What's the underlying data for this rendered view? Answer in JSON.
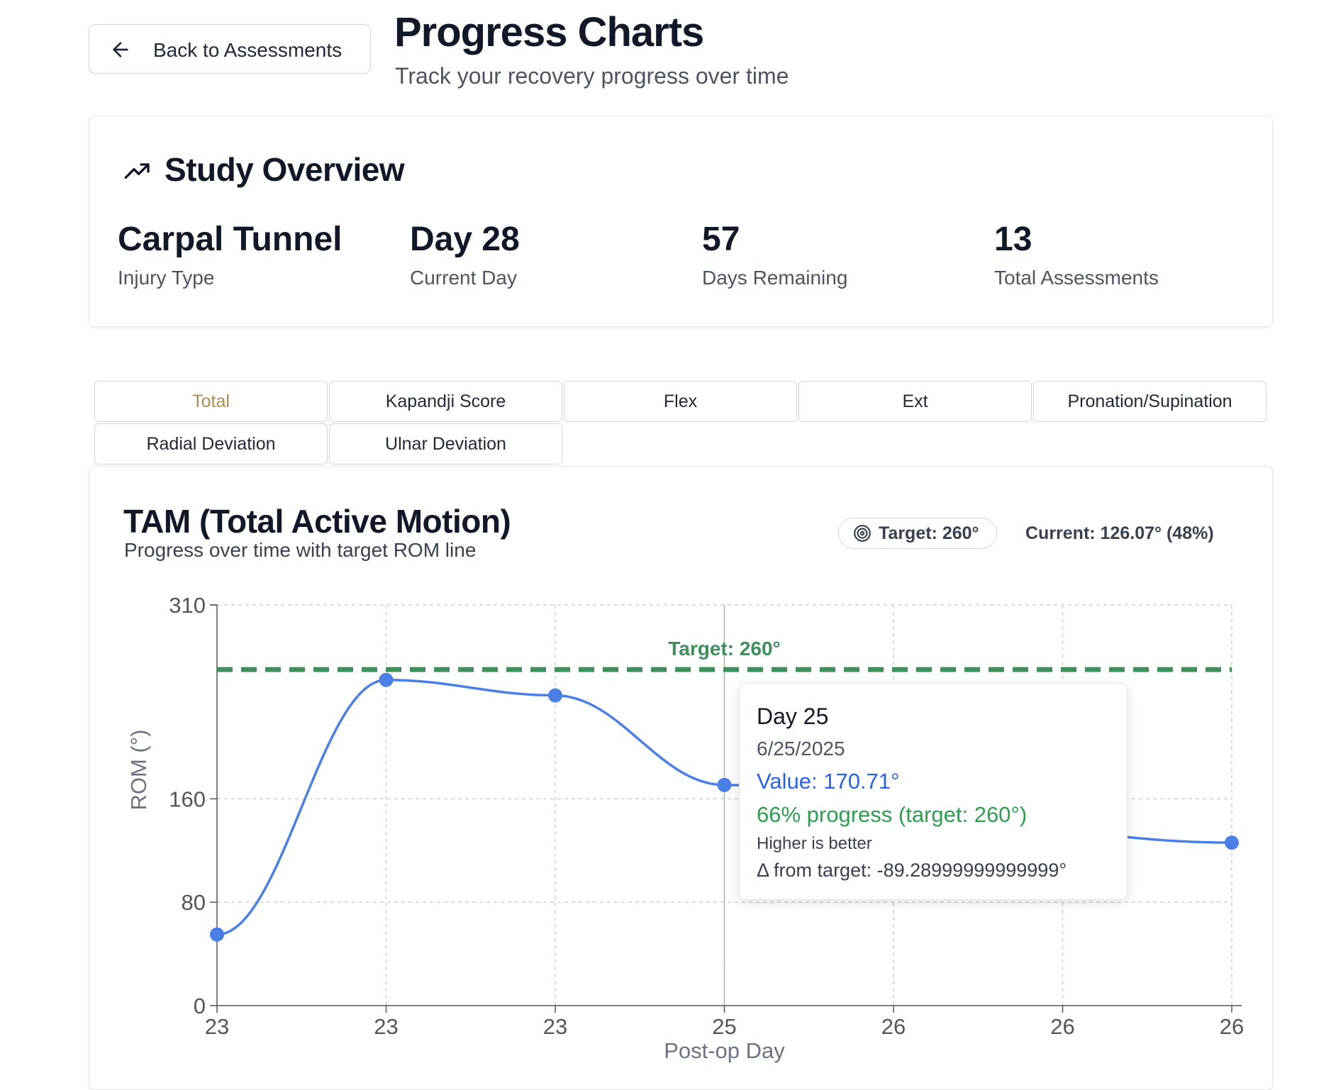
{
  "header": {
    "back_label": "Back to Assessments",
    "title": "Progress Charts",
    "subtitle": "Track your recovery progress over time"
  },
  "overview": {
    "title": "Study Overview",
    "stats": [
      {
        "value": "Carpal Tunnel",
        "label": "Injury Type"
      },
      {
        "value": "Day 28",
        "label": "Current Day"
      },
      {
        "value": "57",
        "label": "Days Remaining"
      },
      {
        "value": "13",
        "label": "Total Assessments"
      }
    ]
  },
  "tabs": [
    {
      "label": "Total",
      "active": true
    },
    {
      "label": "Kapandji Score",
      "active": false
    },
    {
      "label": "Flex",
      "active": false
    },
    {
      "label": "Ext",
      "active": false
    },
    {
      "label": "Pronation/Supination",
      "active": false
    },
    {
      "label": "Radial Deviation",
      "active": false
    },
    {
      "label": "Ulnar Deviation",
      "active": false
    }
  ],
  "chart_card": {
    "title": "TAM (Total Active Motion)",
    "subtitle": "Progress over time with target ROM line",
    "target_badge": "Target: 260°",
    "current": "Current: 126.07° (48%)"
  },
  "tooltip": {
    "day": "Day 25",
    "date": "6/25/2025",
    "value": "Value: 170.71°",
    "progress": "66% progress (target: 260°)",
    "note": "Higher is better",
    "delta": "Δ from target: -89.28999999999999°"
  },
  "colors": {
    "line": "#4a7fe8",
    "point": "#4a7fe8",
    "target": "#3d8f5b",
    "grid": "#cfcfcf",
    "active_tab": "#b08a4e"
  },
  "chart_data": {
    "type": "line",
    "title": "TAM (Total Active Motion)",
    "xlabel": "Post-op Day",
    "ylabel": "ROM (°)",
    "x": [
      "23",
      "23",
      "23",
      "25",
      "26",
      "26",
      "26"
    ],
    "series": [
      {
        "values": [
          55,
          252,
          240,
          170.71,
          null,
          null,
          126.07
        ]
      }
    ],
    "target": {
      "value": 260,
      "label": "Target: 260°"
    },
    "y_ticks": [
      0,
      80,
      160,
      310
    ],
    "ylim": [
      0,
      310
    ],
    "grid": true,
    "hover_index": 3
  }
}
